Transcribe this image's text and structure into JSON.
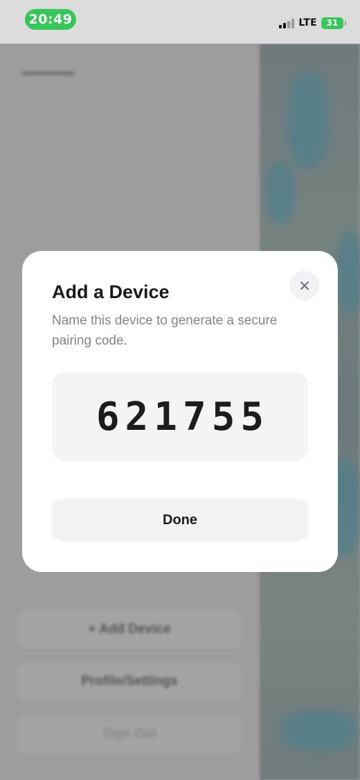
{
  "status_bar": {
    "time": "20:49",
    "network": "LTE",
    "battery_level": "31",
    "signal_bars_active": 2,
    "signal_bars_total": 4,
    "time_pill_color": "#35c759",
    "battery_color": "#35c759"
  },
  "modal": {
    "title": "Add a Device",
    "subtitle": "Name this device to generate a secure pairing code.",
    "pairing_code": "621755",
    "done_label": "Done",
    "close_icon": "close-icon"
  },
  "background": {
    "add_device_label": "+ Add Device",
    "profile_settings_label": "Profile/Settings",
    "sign_out_label": "Sign Out"
  }
}
